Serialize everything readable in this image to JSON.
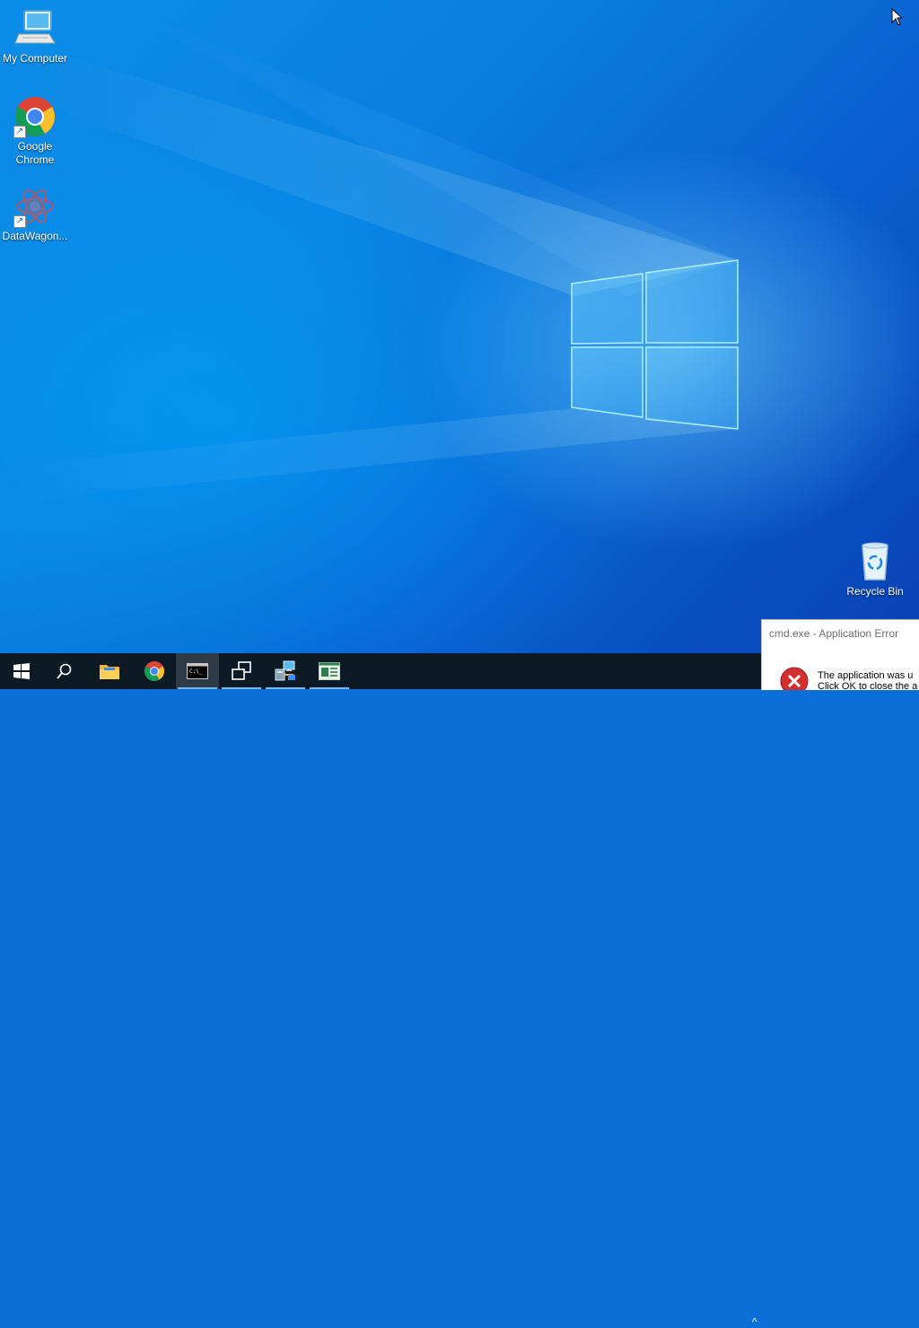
{
  "desktop": {
    "icons": [
      {
        "label": "My Computer",
        "icon": "computer-icon",
        "shortcut": false
      },
      {
        "label": "Google\nChrome",
        "icon": "chrome-icon",
        "shortcut": true
      },
      {
        "label": "DataWagon...",
        "icon": "datawagon-icon",
        "shortcut": true
      }
    ],
    "recycle_bin": {
      "label": "Recycle Bin",
      "icon": "recycle-bin-icon"
    }
  },
  "taskbar": {
    "buttons": [
      {
        "name": "start-button",
        "icon": "windows-logo-icon",
        "active": false,
        "running": false
      },
      {
        "name": "search-button",
        "icon": "search-icon",
        "active": false,
        "running": false
      },
      {
        "name": "file-explorer-button",
        "icon": "folder-icon",
        "active": false,
        "running": false
      },
      {
        "name": "chrome-taskbar-button",
        "icon": "chrome-icon",
        "active": false,
        "running": false
      },
      {
        "name": "cmd-taskbar-button",
        "icon": "cmd-icon",
        "active": true,
        "running": true
      },
      {
        "name": "window-manager-button",
        "icon": "windows-overlap-icon",
        "active": false,
        "running": true
      },
      {
        "name": "network-tool-button",
        "icon": "network-computer-icon",
        "active": false,
        "running": true
      },
      {
        "name": "app-window-button",
        "icon": "app-window-icon",
        "active": false,
        "running": true
      }
    ],
    "tray_arrow": "^"
  },
  "dialog": {
    "title": "cmd.exe - Application Error",
    "message_line1": "The application was u",
    "message_line2": "Click OK to close the a",
    "icon": "error-icon"
  },
  "colors": {
    "taskbar": "#0c1a26",
    "accent": "#76b9ed",
    "error": "#d32f2f"
  }
}
